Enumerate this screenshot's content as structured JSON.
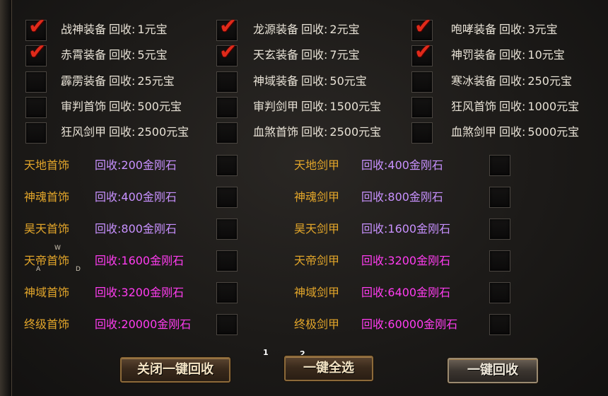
{
  "top_items": [
    {
      "label": "战神装备",
      "recycle": "回收:",
      "price": "1元宝",
      "checked": true
    },
    {
      "label": "龙源装备",
      "recycle": "回收:",
      "price": "2元宝",
      "checked": true
    },
    {
      "label": "咆哮装备",
      "recycle": "回收:",
      "price": "3元宝",
      "checked": true
    },
    {
      "label": "赤霄装备",
      "recycle": "回收:",
      "price": "5元宝",
      "checked": true
    },
    {
      "label": "天玄装备",
      "recycle": "回收:",
      "price": "7元宝",
      "checked": true
    },
    {
      "label": "神罚装备",
      "recycle": "回收:",
      "price": "10元宝",
      "checked": true
    },
    {
      "label": "霹雳装备",
      "recycle": "回收:",
      "price": "25元宝",
      "checked": false
    },
    {
      "label": "神域装备",
      "recycle": "回收:",
      "price": "50元宝",
      "checked": false
    },
    {
      "label": "寒冰装备",
      "recycle": "回收:",
      "price": "250元宝",
      "checked": false
    },
    {
      "label": "审判首饰",
      "recycle": "回收:",
      "price": "500元宝",
      "checked": false
    },
    {
      "label": "审判剑甲",
      "recycle": "回收:",
      "price": "1500元宝",
      "checked": false
    },
    {
      "label": "狂风首饰",
      "recycle": "回收:",
      "price": "1000元宝",
      "checked": false
    },
    {
      "label": "狂风剑甲",
      "recycle": "回收:",
      "price": "2500元宝",
      "checked": false
    },
    {
      "label": "血煞首饰",
      "recycle": "回收:",
      "price": "2500元宝",
      "checked": false
    },
    {
      "label": "血煞剑甲",
      "recycle": "回收:",
      "price": "5000元宝",
      "checked": false
    }
  ],
  "diamond_items": [
    {
      "label": "天地首饰",
      "price": "回收:200金刚石",
      "color": "lav"
    },
    {
      "label": "天地剑甲",
      "price": "回收:400金刚石",
      "color": "lav"
    },
    {
      "label": "神魂首饰",
      "price": "回收:400金刚石",
      "color": "lav"
    },
    {
      "label": "神魂剑甲",
      "price": "回收:800金刚石",
      "color": "lav"
    },
    {
      "label": "昊天首饰",
      "price": "回收:800金刚石",
      "color": "lav"
    },
    {
      "label": "昊天剑甲",
      "price": "回收:1600金刚石",
      "color": "lav"
    },
    {
      "label": "天帝首饰",
      "price": "回收:1600金刚石",
      "color": "mag"
    },
    {
      "label": "天帝剑甲",
      "price": "回收:3200金刚石",
      "color": "mag"
    },
    {
      "label": "神域首饰",
      "price": "回收:3200金刚石",
      "color": "mag"
    },
    {
      "label": "神域剑甲",
      "price": "回收:6400金刚石",
      "color": "mag"
    },
    {
      "label": "终级首饰",
      "price": "回收:20000金刚石",
      "color": "mag"
    },
    {
      "label": "终极剑甲",
      "price": "回收:60000金刚石",
      "color": "mag"
    }
  ],
  "buttons": {
    "close_auto": "关闭一键回收",
    "select_all": "一键全选",
    "recycle": "一键回收"
  },
  "hotkeys": {
    "one": "1",
    "two": "2"
  },
  "wasd": {
    "w": "W",
    "a": "A",
    "d": "D"
  },
  "colors": {
    "check": "#e02a1a",
    "gold": "#e2a52a",
    "lavender": "#c891ff",
    "magenta": "#ff3cf0"
  }
}
